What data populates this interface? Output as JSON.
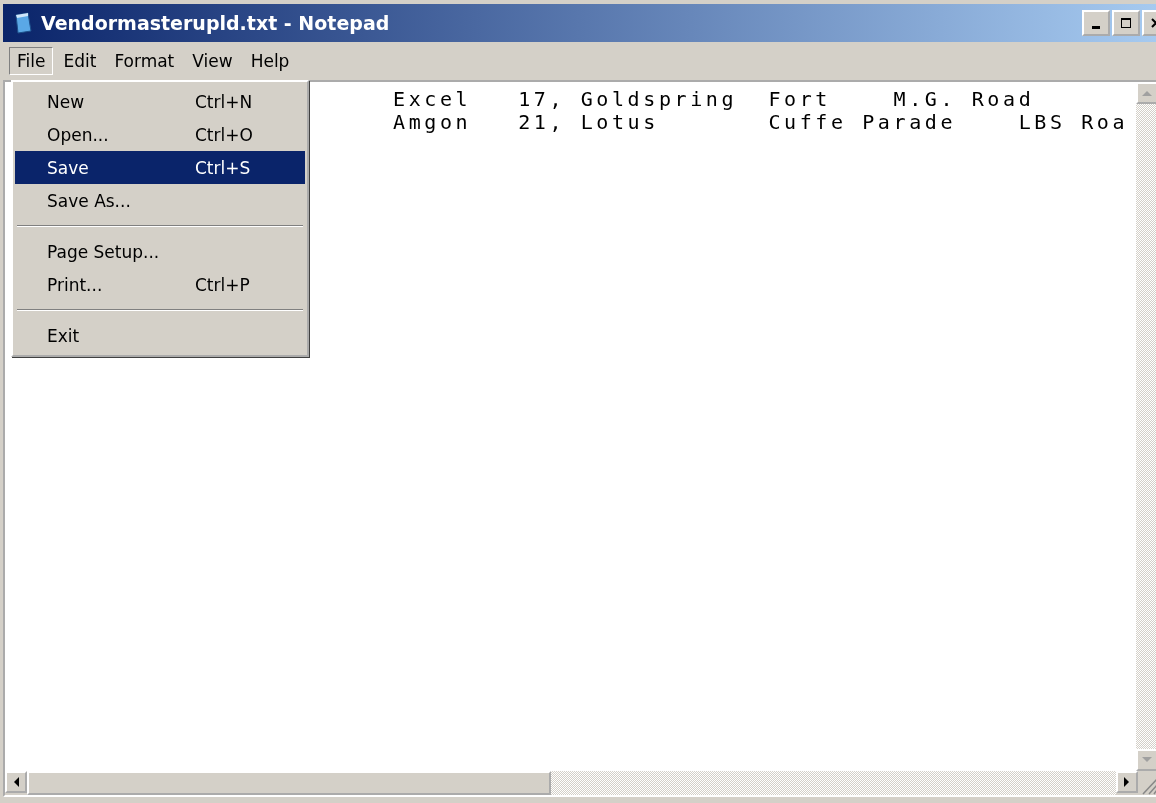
{
  "window": {
    "title": "Vendormasterupld.txt - Notepad"
  },
  "menu_bar": [
    {
      "label": "File",
      "selected": true
    },
    {
      "label": "Edit",
      "selected": false
    },
    {
      "label": "Format",
      "selected": false
    },
    {
      "label": "View",
      "selected": false
    },
    {
      "label": "Help",
      "selected": false
    }
  ],
  "file_menu": [
    {
      "kind": "item",
      "label": "New",
      "shortcut": "Ctrl+N",
      "selected": false
    },
    {
      "kind": "item",
      "label": "Open...",
      "shortcut": "Ctrl+O",
      "selected": false
    },
    {
      "kind": "item",
      "label": "Save",
      "shortcut": "Ctrl+S",
      "selected": true
    },
    {
      "kind": "item",
      "label": "Save As...",
      "selected": false
    },
    {
      "kind": "separator"
    },
    {
      "kind": "item",
      "label": "Page Setup...",
      "selected": false
    },
    {
      "kind": "item",
      "label": "Print...",
      "shortcut": "Ctrl+P",
      "selected": false
    },
    {
      "kind": "separator"
    },
    {
      "kind": "item",
      "label": "Exit",
      "selected": false
    }
  ],
  "editor": {
    "lines": [
      "Excel   17, Goldspring  Fort    M.G. Road",
      "Amgon   21, Lotus       Cuffe Parade    LBS Roa"
    ]
  }
}
